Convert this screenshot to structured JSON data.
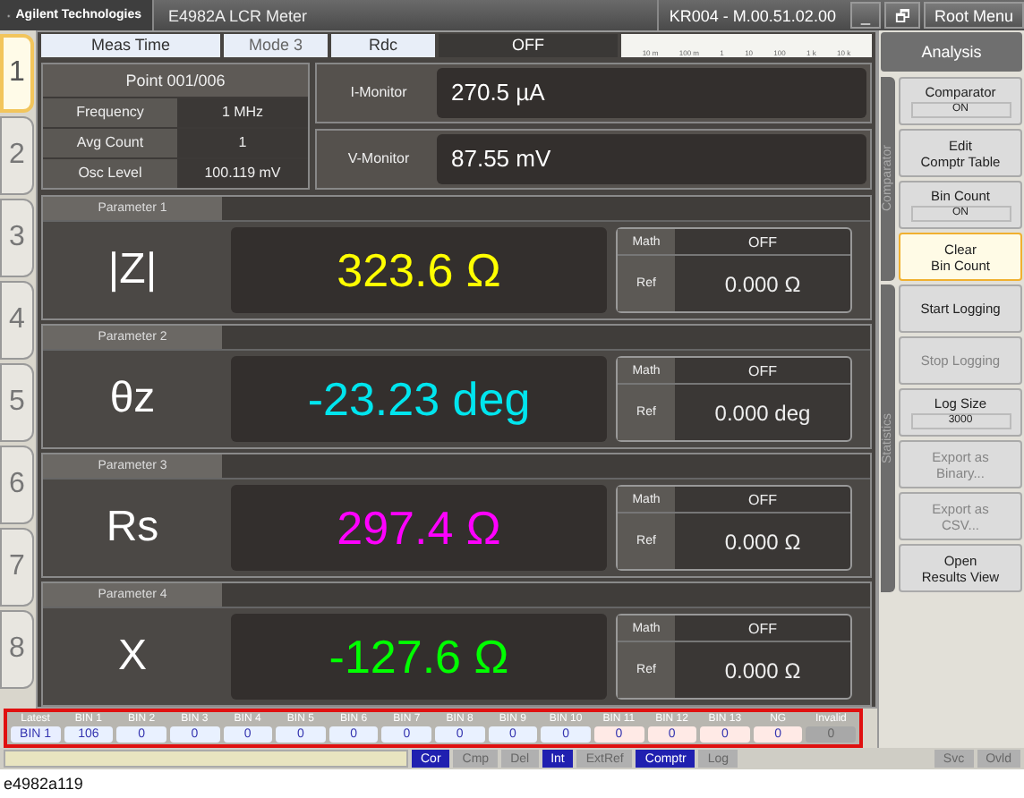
{
  "title_bar": {
    "brand": "Agilent Technologies",
    "title": "E4982A LCR Meter",
    "version": "KR004 - M.00.51.02.00",
    "minimize": "_",
    "restore": "🗗",
    "menu": "Root Menu"
  },
  "channel_tabs": [
    {
      "label": "1",
      "selected": true
    },
    {
      "label": "2",
      "selected": false
    },
    {
      "label": "3",
      "selected": false
    },
    {
      "label": "4",
      "selected": false
    },
    {
      "label": "5",
      "selected": false
    },
    {
      "label": "6",
      "selected": false
    },
    {
      "label": "7",
      "selected": false
    },
    {
      "label": "8",
      "selected": false
    }
  ],
  "top_strip": {
    "meas_time_label": "Meas Time",
    "meas_time": "Mode 3",
    "rdc_label": "Rdc",
    "rdc": "OFF",
    "scale_labels": [
      "10 m",
      "100 m",
      "1",
      "10",
      "100",
      "1 k",
      "10 k"
    ]
  },
  "point_table": {
    "title": "Point 001/006",
    "rows": [
      {
        "label": "Frequency",
        "value": "1 MHz"
      },
      {
        "label": "Avg Count",
        "value": "1"
      },
      {
        "label": "Osc Level",
        "value": "100.119 mV"
      }
    ]
  },
  "monitors": [
    {
      "label": "I-Monitor",
      "value": "270.5 µA"
    },
    {
      "label": "V-Monitor",
      "value": "87.55 mV"
    }
  ],
  "parameters": [
    {
      "title": "Parameter 1",
      "name": "|Z|",
      "value": "323.6 Ω",
      "color": "#ffff00",
      "math_label": "Math",
      "math": "OFF",
      "ref_label": "Ref",
      "ref": "0.000 Ω"
    },
    {
      "title": "Parameter 2",
      "name": "θz",
      "value": "-23.23 deg",
      "color": "#00e5ee",
      "math_label": "Math",
      "math": "OFF",
      "ref_label": "Ref",
      "ref": "0.000 deg"
    },
    {
      "title": "Parameter 3",
      "name": "Rs",
      "value": "297.4 Ω",
      "color": "#ff00ff",
      "math_label": "Math",
      "math": "OFF",
      "ref_label": "Ref",
      "ref": "0.000 Ω"
    },
    {
      "title": "Parameter 4",
      "name": "X",
      "value": "-127.6 Ω",
      "color": "#00ff00",
      "math_label": "Math",
      "math": "OFF",
      "ref_label": "Ref",
      "ref": "0.000 Ω"
    }
  ],
  "bins": [
    {
      "label": "Latest",
      "value": "BIN 1",
      "kind": "latest"
    },
    {
      "label": "BIN 1",
      "value": "106",
      "kind": "pass"
    },
    {
      "label": "BIN 2",
      "value": "0",
      "kind": "pass"
    },
    {
      "label": "BIN 3",
      "value": "0",
      "kind": "pass"
    },
    {
      "label": "BIN 4",
      "value": "0",
      "kind": "pass"
    },
    {
      "label": "BIN 5",
      "value": "0",
      "kind": "pass"
    },
    {
      "label": "BIN 6",
      "value": "0",
      "kind": "pass"
    },
    {
      "label": "BIN 7",
      "value": "0",
      "kind": "pass"
    },
    {
      "label": "BIN 8",
      "value": "0",
      "kind": "pass"
    },
    {
      "label": "BIN 9",
      "value": "0",
      "kind": "pass"
    },
    {
      "label": "BIN 10",
      "value": "0",
      "kind": "pass"
    },
    {
      "label": "BIN 11",
      "value": "0",
      "kind": "fail"
    },
    {
      "label": "BIN 12",
      "value": "0",
      "kind": "fail"
    },
    {
      "label": "BIN 13",
      "value": "0",
      "kind": "fail"
    },
    {
      "label": "NG",
      "value": "0",
      "kind": "fail"
    },
    {
      "label": "Invalid",
      "value": "0",
      "kind": "invalid"
    }
  ],
  "analysis": {
    "title": "Analysis",
    "groups": [
      {
        "label": "Comparator",
        "buttons": [
          {
            "label": "Comparator",
            "value": "ON",
            "disabled": false,
            "selected": false
          },
          {
            "label": "Edit\nComptr Table",
            "disabled": false,
            "selected": false
          },
          {
            "label": "Bin Count",
            "value": "ON",
            "disabled": false,
            "selected": false
          },
          {
            "label": "Clear\nBin Count",
            "disabled": false,
            "selected": true
          }
        ]
      },
      {
        "label": "Statistics",
        "buttons": [
          {
            "label": "Start Logging",
            "disabled": false,
            "selected": false
          },
          {
            "label": "Stop Logging",
            "disabled": true,
            "selected": false
          },
          {
            "label": "Log Size",
            "value": "3000",
            "disabled": false,
            "selected": false
          },
          {
            "label": "Export as\nBinary...",
            "disabled": true,
            "selected": false
          },
          {
            "label": "Export as\nCSV...",
            "disabled": true,
            "selected": false
          },
          {
            "label": "Open\nResults View",
            "disabled": false,
            "selected": false
          }
        ]
      }
    ]
  },
  "status_bar": {
    "left": [
      {
        "label": "Cor",
        "on": true
      },
      {
        "label": "Cmp",
        "on": false
      },
      {
        "label": "Del",
        "on": false
      },
      {
        "label": "Int",
        "on": true
      },
      {
        "label": "ExtRef",
        "on": false
      },
      {
        "label": "Comptr",
        "on": true
      },
      {
        "label": "Log",
        "on": false
      }
    ],
    "right": [
      {
        "label": "Svc",
        "on": false
      },
      {
        "label": "Ovld",
        "on": false
      }
    ]
  },
  "caption": "e4982a119"
}
